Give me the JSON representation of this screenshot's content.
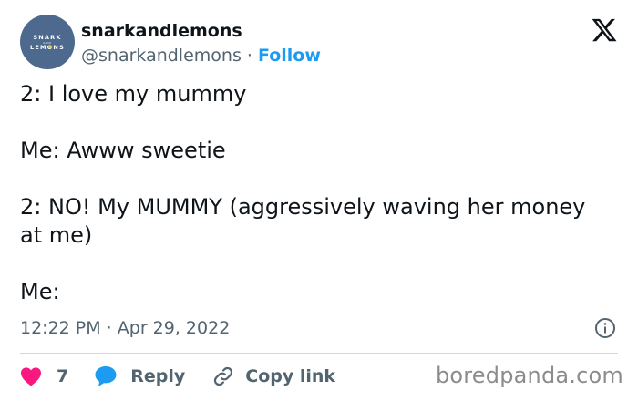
{
  "author": {
    "name": "snarkandlemons",
    "handle": "@snarkandlemons",
    "separator": "·",
    "follow_label": "Follow",
    "avatar_text_top": "SNARK",
    "avatar_text_mid": "AND",
    "avatar_text_bottom": "LEMONS",
    "avatar_color": "#4d6a8e"
  },
  "tweet": {
    "lines": [
      "2: I love my mummy",
      "Me: Awww sweetie",
      "2: NO! My MUMMY (aggressively waving her money at me)",
      "Me:"
    ],
    "timestamp": "12:22 PM · Apr 29, 2022"
  },
  "actions": {
    "like_count": "7",
    "reply_label": "Reply",
    "copy_label": "Copy link",
    "like_color": "#f91880",
    "reply_color": "#1d9bf0"
  },
  "watermark": "boredpanda.com",
  "icons": {
    "logo": "x-logo-icon",
    "info": "info-icon",
    "like": "heart-icon",
    "reply": "speech-bubble-icon",
    "copy": "link-icon"
  }
}
